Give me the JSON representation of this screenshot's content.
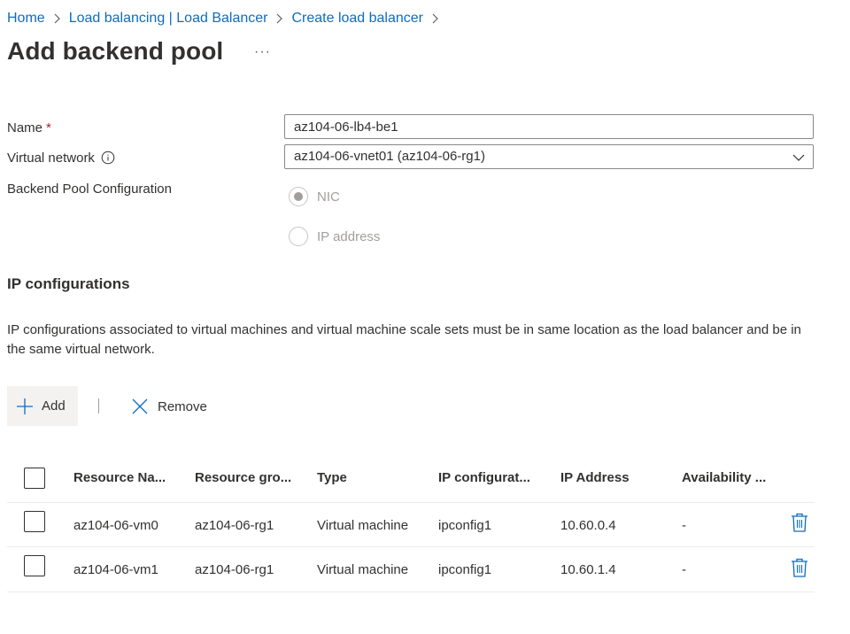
{
  "breadcrumb": [
    {
      "label": "Home"
    },
    {
      "label": "Load balancing | Load Balancer"
    },
    {
      "label": "Create load balancer"
    }
  ],
  "page": {
    "title": "Add backend pool",
    "more_label": "···"
  },
  "form": {
    "name_label": "Name",
    "required_mark": "*",
    "name_value": "az104-06-lb4-be1",
    "vnet_label": "Virtual network",
    "vnet_value": "az104-06-vnet01 (az104-06-rg1)",
    "pool_config_label": "Backend Pool Configuration",
    "options": [
      {
        "label": "NIC",
        "checked": true
      },
      {
        "label": "IP address",
        "checked": false
      }
    ]
  },
  "ip_config": {
    "title": "IP configurations",
    "description": "IP configurations associated to virtual machines and virtual machine scale sets must be in same location as the load balancer and be in the same virtual network."
  },
  "toolbar": {
    "add_label": "Add",
    "remove_label": "Remove"
  },
  "table": {
    "headers": [
      "Resource Na...",
      "Resource gro...",
      "Type",
      "IP configurat...",
      "IP Address",
      "Availability ..."
    ],
    "rows": [
      {
        "resource_name": "az104-06-vm0",
        "resource_group": "az104-06-rg1",
        "type": "Virtual machine",
        "ip_config": "ipconfig1",
        "ip_address": "10.60.0.4",
        "availability": "-"
      },
      {
        "resource_name": "az104-06-vm1",
        "resource_group": "az104-06-rg1",
        "type": "Virtual machine",
        "ip_config": "ipconfig1",
        "ip_address": "10.60.1.4",
        "availability": "-"
      }
    ]
  },
  "colors": {
    "link": "#0f6cbd",
    "required": "#a4262c",
    "disabled_text": "#a19f9d",
    "delete_icon": "#0f6cbd"
  }
}
